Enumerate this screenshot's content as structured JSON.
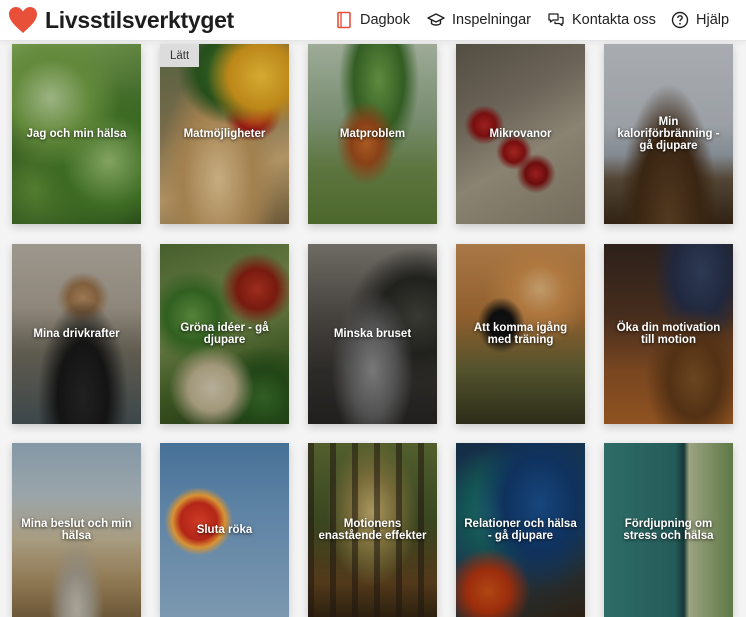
{
  "app": {
    "name": "Livsstilsverktyget",
    "brand_color": "#e8503a"
  },
  "nav": [
    {
      "label": "Dagbok",
      "icon": "diary-icon"
    },
    {
      "label": "Inspelningar",
      "icon": "graduation-cap-icon"
    },
    {
      "label": "Kontakta oss",
      "icon": "chat-bubbles-icon"
    },
    {
      "label": "Hjälp",
      "icon": "help-circle-icon"
    }
  ],
  "cards": [
    {
      "label": "Jag och min hälsa",
      "image": "green-plants"
    },
    {
      "label": "Matmöjligheter",
      "image": "vegetable-basket",
      "badge": "Lätt"
    },
    {
      "label": "Matproblem",
      "image": "carrots"
    },
    {
      "label": "Mikrovanor",
      "image": "raspberries"
    },
    {
      "label": "Min kaloriförbränning - gå djupare",
      "image": "hikers"
    },
    {
      "label": "Mina drivkrafter",
      "image": "man-vest"
    },
    {
      "label": "Gröna idéer - gå djupare",
      "image": "groceries"
    },
    {
      "label": "Minska bruset",
      "image": "messy-room"
    },
    {
      "label": "Att komma igång med träning",
      "image": "runner"
    },
    {
      "label": "Öka din motivation till motion",
      "image": "boots-leaves"
    },
    {
      "label": "Mina beslut och min hälsa",
      "image": "path-grass"
    },
    {
      "label": "Sluta röka",
      "image": "balloon"
    },
    {
      "label": "Motionens enastående effekter",
      "image": "forest"
    },
    {
      "label": "Relationer och hälsa - gå djupare",
      "image": "parrots"
    },
    {
      "label": "Fördjupning om stress och hälsa",
      "image": "door"
    }
  ]
}
